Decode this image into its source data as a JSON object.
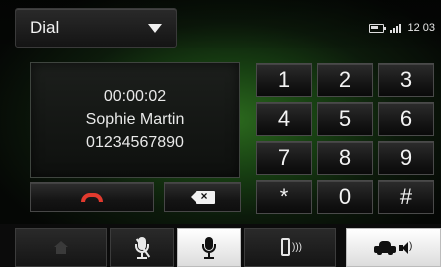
{
  "header": {
    "dial_label": "Dial",
    "time": "12 03",
    "battery_icon": "battery-icon",
    "signal_icon": "signal-icon"
  },
  "call": {
    "duration": "00:00:02",
    "contact_name": "Sophie Martin",
    "number": "01234567890"
  },
  "controls": {
    "hangup_icon": "hang-up-icon",
    "hangup_color": "#e23a2e",
    "backspace_icon": "backspace-icon"
  },
  "keypad": {
    "keys": [
      "1",
      "2",
      "3",
      "4",
      "5",
      "6",
      "7",
      "8",
      "9",
      "*",
      "0",
      "#"
    ]
  },
  "bottom_nav": {
    "tabs": [
      {
        "icon": "home-icon",
        "active": false
      },
      {
        "icon": "mic-mute-icon",
        "active": false
      },
      {
        "icon": "microphone-icon",
        "active": true
      },
      {
        "icon": "phone-audio-icon",
        "active": false
      },
      {
        "icon": "car-speaker-icon",
        "active": true
      }
    ]
  }
}
